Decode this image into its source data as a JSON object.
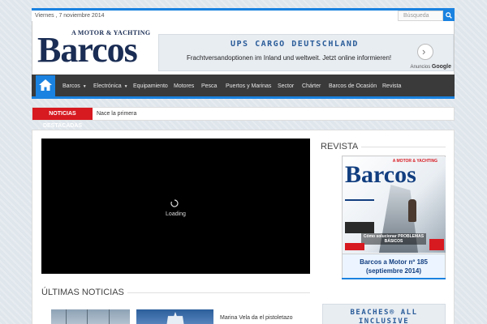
{
  "topbar": {
    "date": "Viernes , 7 noviembre 2014",
    "search_placeholder": "Búsqueda"
  },
  "header": {
    "logo_tag": "A MOTOR & YACHTING",
    "logo_name": "Barcos",
    "ad": {
      "title": "UPS CARGO DEUTSCHLAND",
      "text": "Frachtversandoptionen im Inland und weltweit. Jetzt online informieren!",
      "attribution_prefix": "Anuncios",
      "attribution_brand": "Google"
    }
  },
  "nav": {
    "items": [
      {
        "label": "Barcos",
        "dropdown": true
      },
      {
        "label": "Electrónica",
        "dropdown": true
      },
      {
        "label": "Equipamiento",
        "dropdown": false
      },
      {
        "label": "Motores",
        "dropdown": false
      },
      {
        "label": "Pesca",
        "dropdown": false
      },
      {
        "label": "Puertos y Marinas",
        "dropdown": false
      },
      {
        "label": "Sector",
        "dropdown": false
      },
      {
        "label": "Chárter",
        "dropdown": false
      },
      {
        "label": "Barcos de Ocasión",
        "dropdown": false
      },
      {
        "label": "Revista",
        "dropdown": false
      }
    ]
  },
  "breaking": {
    "label": "NOTICIAS DESTACADAS",
    "ticker": "Nace la primera"
  },
  "video": {
    "loading_text": "Loading"
  },
  "latest": {
    "title": "ÚLTIMAS NOTICIAS",
    "items": [
      {
        "title": "Marina Vela da el pistoletazo"
      }
    ]
  },
  "revista": {
    "title": "REVISTA",
    "cover_tag": "A MOTOR & YACHTING",
    "cover_name": "Barcos",
    "cover_headline": "Cómo solucionar PROBLEMAS BÁSICOS",
    "caption_line1": "Barcos a Motor nº 185",
    "caption_line2": "(septiembre 2014)"
  },
  "side_ad": {
    "text_line1": "BEACHES® ALL",
    "text_line2": "INCLUSIVE"
  },
  "colors": {
    "accent": "#1a82e0",
    "brand_navy": "#1a2d54",
    "breaking_red": "#d71920",
    "nav_bg": "#3a3a3a"
  }
}
